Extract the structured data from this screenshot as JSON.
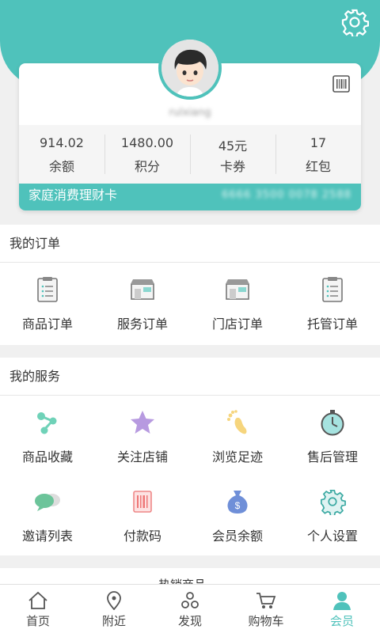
{
  "profile": {
    "username": "rulxiang",
    "stats": [
      {
        "value": "914.02",
        "label": "余额"
      },
      {
        "value": "1480.00",
        "label": "积分"
      },
      {
        "value": "45元",
        "label": "卡券"
      },
      {
        "value": "17",
        "label": "红包"
      }
    ],
    "card_name": "家庭消费理财卡",
    "card_number": "6666 3500 0078 2588"
  },
  "orders": {
    "title": "我的订单",
    "items": [
      {
        "label": "商品订单",
        "icon": "clipboard-icon"
      },
      {
        "label": "服务订单",
        "icon": "shop-icon"
      },
      {
        "label": "门店订单",
        "icon": "shop-icon"
      },
      {
        "label": "托管订单",
        "icon": "clipboard-icon"
      }
    ]
  },
  "services": {
    "title": "我的服务",
    "items": [
      {
        "label": "商品收藏",
        "icon": "share-nodes-icon"
      },
      {
        "label": "关注店铺",
        "icon": "star-icon"
      },
      {
        "label": "浏览足迹",
        "icon": "footprint-icon"
      },
      {
        "label": "售后管理",
        "icon": "stopwatch-icon"
      },
      {
        "label": "邀请列表",
        "icon": "chat-bubbles-icon"
      },
      {
        "label": "付款码",
        "icon": "barcode-icon"
      },
      {
        "label": "会员余额",
        "icon": "money-bag-icon"
      },
      {
        "label": "个人设置",
        "icon": "gear-icon"
      }
    ]
  },
  "peek_title": "热销商品",
  "tabs": [
    {
      "label": "首页",
      "icon": "home-icon"
    },
    {
      "label": "附近",
      "icon": "location-icon"
    },
    {
      "label": "发现",
      "icon": "discover-icon"
    },
    {
      "label": "购物车",
      "icon": "cart-icon"
    },
    {
      "label": "会员",
      "icon": "member-icon",
      "active": true
    }
  ],
  "colors": {
    "accent": "#4fc2bb",
    "background": "#f0f0f0"
  }
}
